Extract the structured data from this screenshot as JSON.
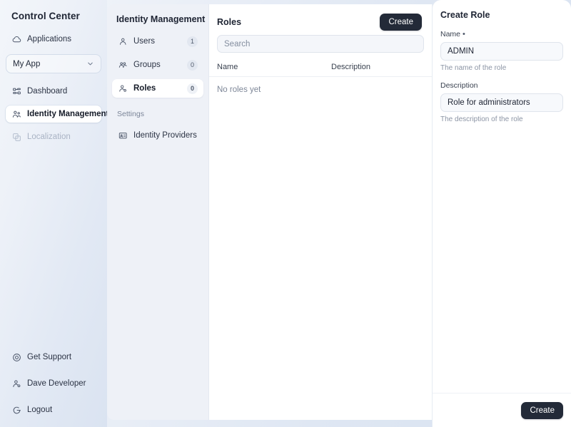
{
  "sidebar": {
    "title": "Control Center",
    "nav_top": [
      {
        "label": "Applications",
        "icon": "cloud-icon",
        "state": "normal"
      }
    ],
    "app_selector": {
      "value": "My App",
      "icon": "chevron-down-icon"
    },
    "nav_main": [
      {
        "label": "Dashboard",
        "icon": "dashboard-icon",
        "state": "normal"
      },
      {
        "label": "Identity Management",
        "icon": "identity-users-icon",
        "state": "active"
      },
      {
        "label": "Localization",
        "icon": "localization-icon",
        "state": "disabled"
      }
    ],
    "footer": [
      {
        "label": "Get Support",
        "icon": "lifebuoy-icon"
      },
      {
        "label": "Dave Developer",
        "icon": "user-gear-icon"
      },
      {
        "label": "Logout",
        "icon": "logout-icon"
      }
    ]
  },
  "idm": {
    "title": "Identity Management",
    "items": [
      {
        "label": "Users",
        "icon": "user-icon",
        "count": "1",
        "state": "normal"
      },
      {
        "label": "Groups",
        "icon": "group-icon",
        "count": "0",
        "state": "normal"
      },
      {
        "label": "Roles",
        "icon": "role-icon",
        "count": "0",
        "state": "active"
      }
    ],
    "section_label": "Settings",
    "settings_items": [
      {
        "label": "Identity Providers",
        "icon": "id-card-icon",
        "state": "normal"
      }
    ]
  },
  "roles": {
    "title": "Roles",
    "create_label": "Create",
    "search_placeholder": "Search",
    "search_value": "",
    "columns": {
      "name": "Name",
      "description": "Description"
    },
    "rows": [],
    "empty_text": "No roles yet"
  },
  "create_role": {
    "title": "Create Role",
    "name_label": "Name",
    "name_required_mark": "•",
    "name_value": "ADMIN",
    "name_hint": "The name of the role",
    "description_label": "Description",
    "description_value": "Role for administrators",
    "description_hint": "The description of the role",
    "submit_label": "Create"
  },
  "colors": {
    "accent_dark": "#232a38",
    "panel_white": "#ffffff",
    "panel_gray": "#eef1f7",
    "text_primary": "#1e2433",
    "text_muted": "#8b94a4"
  }
}
